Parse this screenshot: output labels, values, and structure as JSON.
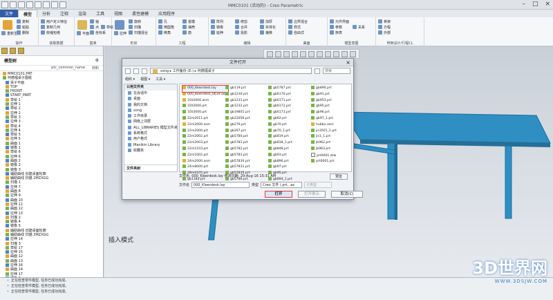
{
  "app": {
    "title": "MMC0101 (活动的) - Creo Parametric",
    "quick_access_icons": [
      "new-icon",
      "open-icon",
      "save-icon",
      "undo-icon",
      "redo-icon",
      "regenerate-icon",
      "window-icon",
      "close-icon"
    ]
  },
  "tabs": [
    "文件",
    "模型",
    "分析",
    "注释",
    "渲染",
    "工具",
    "视图",
    "柔性建模",
    "应用程序"
  ],
  "ribbon": {
    "groups": [
      {
        "label": "操作",
        "items": [
          "重新生成",
          "复制",
          "粘贴",
          "删除"
        ]
      },
      {
        "label": "获取数据",
        "items": [
          "用户定义特征",
          "复制几何",
          "收缩包络"
        ]
      },
      {
        "label": "基准",
        "items": [
          "轴",
          "点",
          "坐标系",
          "草绘",
          "平面"
        ]
      },
      {
        "label": "形状",
        "items": [
          "旋转",
          "扫描",
          "扫描混合",
          "拉伸"
        ]
      },
      {
        "label": "工程",
        "items": [
          "孔",
          "倒圆角",
          "倒角",
          "拔模",
          "抽壳",
          "筋"
        ]
      },
      {
        "label": "编辑",
        "items": [
          "阵列",
          "镜像",
          "延伸",
          "修剪",
          "合并",
          "投影",
          "加厚",
          "实体化",
          "偏移"
        ]
      },
      {
        "label": "曲面",
        "items": [
          "边界混合",
          "样式",
          "自由式"
        ]
      },
      {
        "label": "模型意图",
        "items": [
          "元件界面",
          "参数",
          "关系",
          "族表"
        ]
      },
      {
        "label": "骨架设计/行程CL",
        "items": [
          "骨架",
          "方程",
          "外部"
        ]
      }
    ]
  },
  "tree": {
    "title": "模型树",
    "columns": [
      "ptc_common_name",
      "材料"
    ],
    "nodes": [
      "MMC0101.PRT",
      "何德福桌子图纸",
      "桌子平面",
      "TOP",
      "FRONT",
      "START_PART",
      "草绘 1",
      "拉伸 1",
      "草绘 2",
      "拉伸 2",
      "草绘 3",
      "拉伸 3",
      "草绘 4",
      "拉伸 4",
      "草绘 5",
      "拉伸 5",
      "曲面 1",
      "镜像 1",
      "草绘 6",
      "拉伸 6",
      "曲面 2",
      "镜像 2",
      "镜像 3",
      "辅助曲线 创建桌面轮廓",
      "辅助曲线 扫描 2MZXGG",
      "扫描 1",
      "拉伸 7",
      "曲面 8",
      "拉伸 9",
      "曲面 10",
      "拉伸 11",
      "曲面 12",
      "拉伸 13",
      "扫描 2",
      "镜像 4",
      "镜像 5",
      "辅助曲线 创建桌面轮廓",
      "辅助曲线 扫描 3MZXGG",
      "拉伸 14",
      "扫描 3",
      "草绘 17",
      "拉伸 15",
      "曲面 12",
      "曲面 13",
      "拉伸 16",
      "曲面 14",
      "拉伸 17",
      "镜像 6",
      "在此插入"
    ]
  },
  "graphics": {
    "insert_mode": "插入模式"
  },
  "dialog": {
    "title": "文件打开",
    "address": "song ▸ 工作备份 (E:) ▸ 何德福桌子",
    "search_placeholder": "搜索",
    "toolbar": [
      "组织 ▾",
      "视图 ▾",
      "工具 ▾"
    ],
    "nav_sections": {
      "common": "公用文件夹",
      "items": [
        "在会话中",
        "桌面",
        "我的文档",
        "song",
        "工作目录",
        "网络上邻居",
        "ALL_LIBRARIES 模型文件夹",
        "系统格式",
        "用户格式",
        "Manikin Library",
        "收藏夹"
      ],
      "footer": "文件夹树"
    },
    "files": [
      [
        "000_Kleerdesk.lay",
        "000_Kleerdesk_0619.asm",
        "1Ot2000.asm",
        "1Ot2000.prt",
        "1Ot3000.prt",
        "22m2011.prt",
        "22m2000.asm",
        "22m2000.prt",
        "22m2002.prt",
        "22m2003.prt",
        "22m1103.prt",
        "22m1002.prt",
        "24m2000.asm",
        "24m8000.prt",
        "28m0105.prt",
        "gb1182.prt"
      ],
      [
        "gb119.prt",
        "gb1230.prt",
        "gb1231.prt",
        "gb1232.prt",
        "gb19801.prt",
        "gb22056.prt",
        "gb276.prt",
        "gb297.prt",
        "gb5780.prt",
        "gb5781.prt",
        "gb5782.prt",
        "gb5783.prt",
        "gb57830.prt",
        "gb57831.prt",
        "gb57835.prt",
        "gb5786.prt"
      ],
      [
        "gb5787.prt",
        "gb6170.prt",
        "gb6171.prt",
        "gb6172.prt",
        "gb6173.prt",
        "gb62.prt",
        "gb70.prt",
        "gb70_1.prt",
        "gb819.prt",
        "gb818_1.prt",
        "gb848.prt",
        "gb93.prt",
        "gb896.prt",
        "gb97.prt",
        "gb95.prt",
        "gb894_1.prt"
      ],
      [
        "gb890.prt",
        "gb91.prt",
        "gb953.prt",
        "gb95.prt",
        "gb96.prt",
        "gb97_1.prt",
        "hubbu.asm",
        "jis3501_1.prt",
        "jis1_1.prt",
        "jb962.prt",
        "jb963.prt",
        "prt0001.drw",
        "prt0001.prt"
      ]
    ],
    "selected_file": "000_Kleerdesk.lay",
    "modified_label": "文件名: 000_Kleerdesk.lay  修改日期: 29-Aug-16 15:31 AM",
    "filename_label": "文件名",
    "filename_value": "000_Kleerdesk.lay",
    "type_label": "类型",
    "type_value": "Creo 文件 (.prt, .as",
    "subtype_value": "子类型",
    "preview_label": "预览",
    "buttons": {
      "open": "打开",
      "open_rep": "打开表示",
      "cancel": "取消(C)"
    }
  },
  "status": {
    "messages": [
      "正在检查零件模型, 任务已成功完成。",
      "正在检查零件模型, 任务已成功完成。",
      "正在检查零件模型, 任务已成功完成。"
    ]
  },
  "watermark": {
    "title": "3D世界网",
    "url": "WWW.3DSJW.COM"
  },
  "colors": {
    "accent": "#2d5ea6",
    "highlight": "#e23a3a",
    "model": "#2f8fc3"
  }
}
